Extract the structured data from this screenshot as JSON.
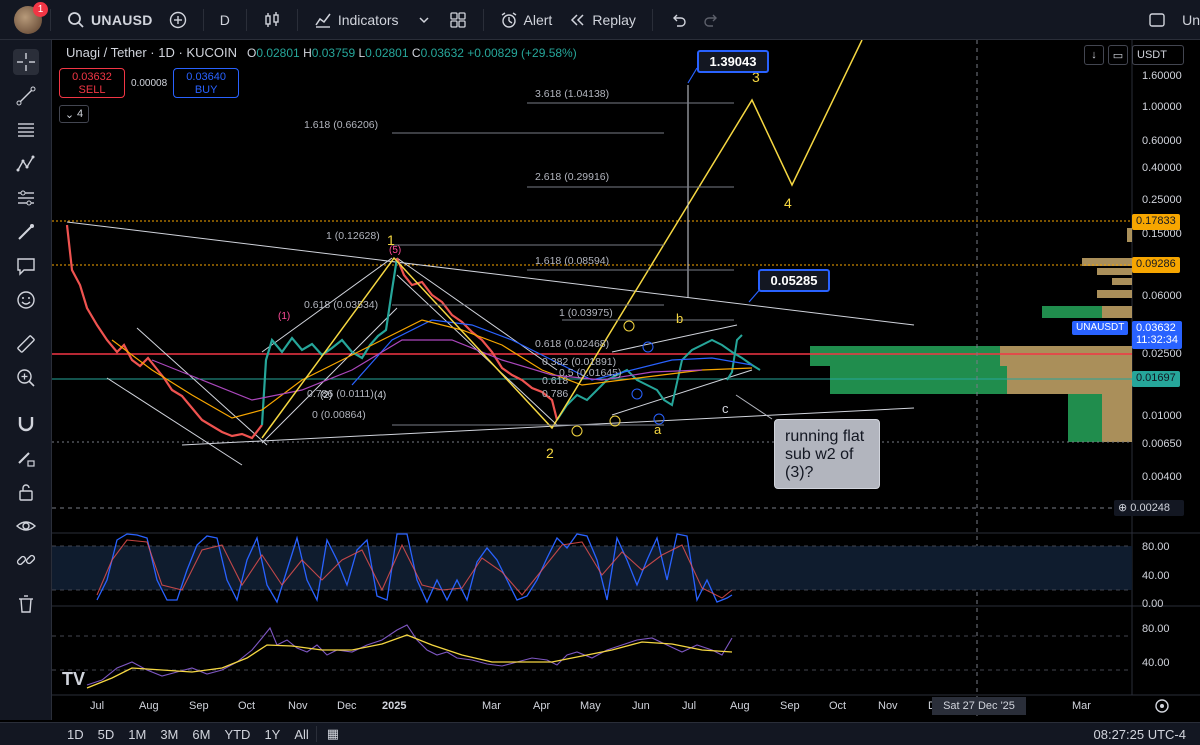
{
  "topbar": {
    "notification_count": "1",
    "symbol": "UNAUSD",
    "interval": "D",
    "indicators_label": "Indicators",
    "alert_label": "Alert",
    "replay_label": "Replay",
    "right_label": "Un"
  },
  "legend": {
    "title": "Unagi / Tether · 1D · KUCOIN",
    "ohlc": {
      "o": "0.02801",
      "h": "0.03759",
      "l": "0.02801",
      "c": "0.03632",
      "change": "+0.00829 (+29.58%)"
    }
  },
  "trade": {
    "sell_price": "0.03632",
    "sell_label": "SELL",
    "spread": "0.00008",
    "buy_price": "0.03640",
    "buy_label": "BUY"
  },
  "indicator_count": "4",
  "currency": "USDT",
  "price_axis": [
    "1.60000",
    "1.00000",
    "0.60000",
    "0.40000",
    "0.25000",
    "0.15000",
    "0.06000",
    "0.02500",
    "0.01000",
    "0.00650",
    "0.00400"
  ],
  "price_tags": {
    "fib_top": "0.17833",
    "fib_mid": "0.09286",
    "symbol_tag": "UNAUSDT",
    "current": "0.03632",
    "countdown": "11:32:34",
    "green_tag": "0.01697",
    "crosshair": "0.00248"
  },
  "osc1_axis": [
    "80.00",
    "40.00",
    "0.00"
  ],
  "osc2_axis": [
    "80.00",
    "40.00"
  ],
  "time_axis": [
    "Jul",
    "Aug",
    "Sep",
    "Oct",
    "Nov",
    "Dec",
    "2025",
    "Mar",
    "Apr",
    "May",
    "Jun",
    "Jul",
    "Aug",
    "Sep",
    "Oct",
    "Nov",
    "D",
    "Mar"
  ],
  "time_tooltip": "Sat 27 Dec '25",
  "fib_labels": {
    "f3618": "3.618 (1.04138)",
    "f1618a": "1.618 (0.66206)",
    "f2618": "2.618 (0.29916)",
    "f1a": "1 (0.12628)",
    "f1618b": "1.618 (0.08594)",
    "f0618a": "0.618 (0.03534)",
    "f1b": "1 (0.03975)",
    "f0618b": "0.618 (0.02468)",
    "f0382": "0.382 (0.01891)",
    "f05": "0.5 (0.01645)",
    "f0618c": "0.618",
    "f0786": "0.786",
    "f0786b": "0.786 (0.0111)",
    "f0": "0 (0.00864)"
  },
  "callouts": {
    "target": "1.39043",
    "line": "0.05285"
  },
  "note": "running flat sub w2 of (3)?",
  "wave_labels": {
    "w1": "1",
    "w2": "2",
    "w3": "3",
    "w4": "4",
    "a": "a",
    "b": "b",
    "c": "c",
    "sub5": "(5)",
    "sub1": "(1)",
    "sub2": "(2)",
    "sub4": "(4)"
  },
  "bottombar": {
    "ranges": [
      "1D",
      "5D",
      "1M",
      "3M",
      "6M",
      "YTD",
      "1Y",
      "All"
    ],
    "clock": "08:27:25 UTC-4"
  },
  "colors": {
    "bg": "#000000",
    "panel": "#131722",
    "accent": "#2962ff",
    "red": "#f23645",
    "green": "#26a69a",
    "yellow": "#f5d742",
    "orange": "#f7a600"
  }
}
